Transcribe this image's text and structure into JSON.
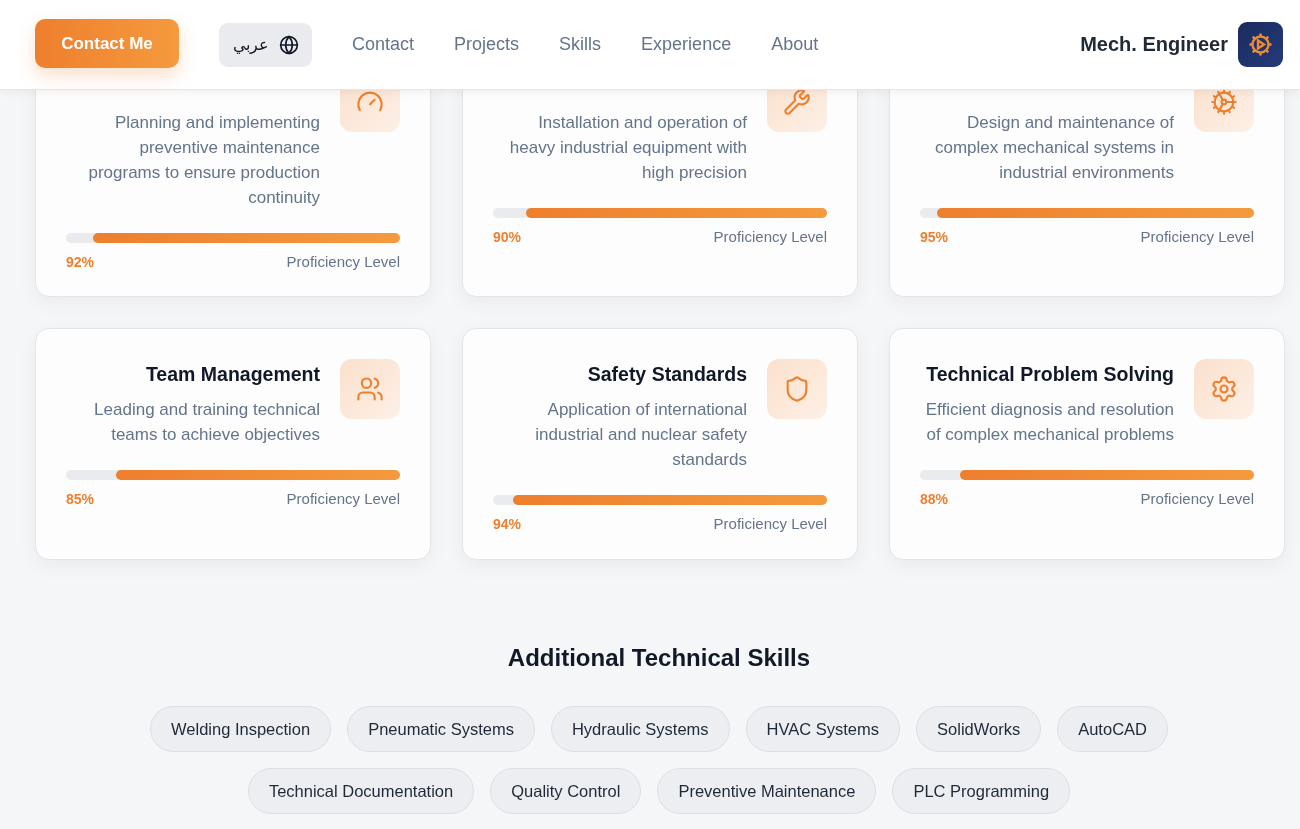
{
  "header": {
    "cta": "Contact Me",
    "language": "عربي",
    "nav": [
      {
        "label": "Contact"
      },
      {
        "label": "Projects"
      },
      {
        "label": "Skills"
      },
      {
        "label": "Experience"
      },
      {
        "label": "About"
      }
    ],
    "brand": "Mech. Engineer"
  },
  "skills": [
    {
      "description": "Planning and implementing preventive maintenance programs to ensure production continuity",
      "level": 0.92,
      "percent": "92%",
      "caption": "Proficiency Level"
    },
    {
      "description": "Installation and operation of heavy industrial equipment with high precision",
      "level": 0.9,
      "percent": "90%",
      "caption": "Proficiency Level"
    },
    {
      "description": "Design and maintenance of complex mechanical systems in industrial environments",
      "level": 0.95,
      "percent": "95%",
      "caption": "Proficiency Level"
    },
    {
      "title": "Team Management",
      "description": "Leading and training technical teams to achieve objectives",
      "level": 0.85,
      "percent": "85%",
      "caption": "Proficiency Level"
    },
    {
      "title": "Safety Standards",
      "description": "Application of international industrial and nuclear safety standards",
      "level": 0.94,
      "percent": "94%",
      "caption": "Proficiency Level"
    },
    {
      "title": "Technical Problem Solving",
      "description": "Efficient diagnosis and resolution of complex mechanical problems",
      "level": 0.88,
      "percent": "88%",
      "caption": "Proficiency Level"
    }
  ],
  "additional": {
    "title": "Additional Technical Skills",
    "tags": [
      "Welding Inspection",
      "Pneumatic Systems",
      "Hydraulic Systems",
      "HVAC Systems",
      "SolidWorks",
      "AutoCAD",
      "Technical Documentation",
      "Quality Control",
      "Preventive Maintenance",
      "PLC Programming"
    ]
  }
}
